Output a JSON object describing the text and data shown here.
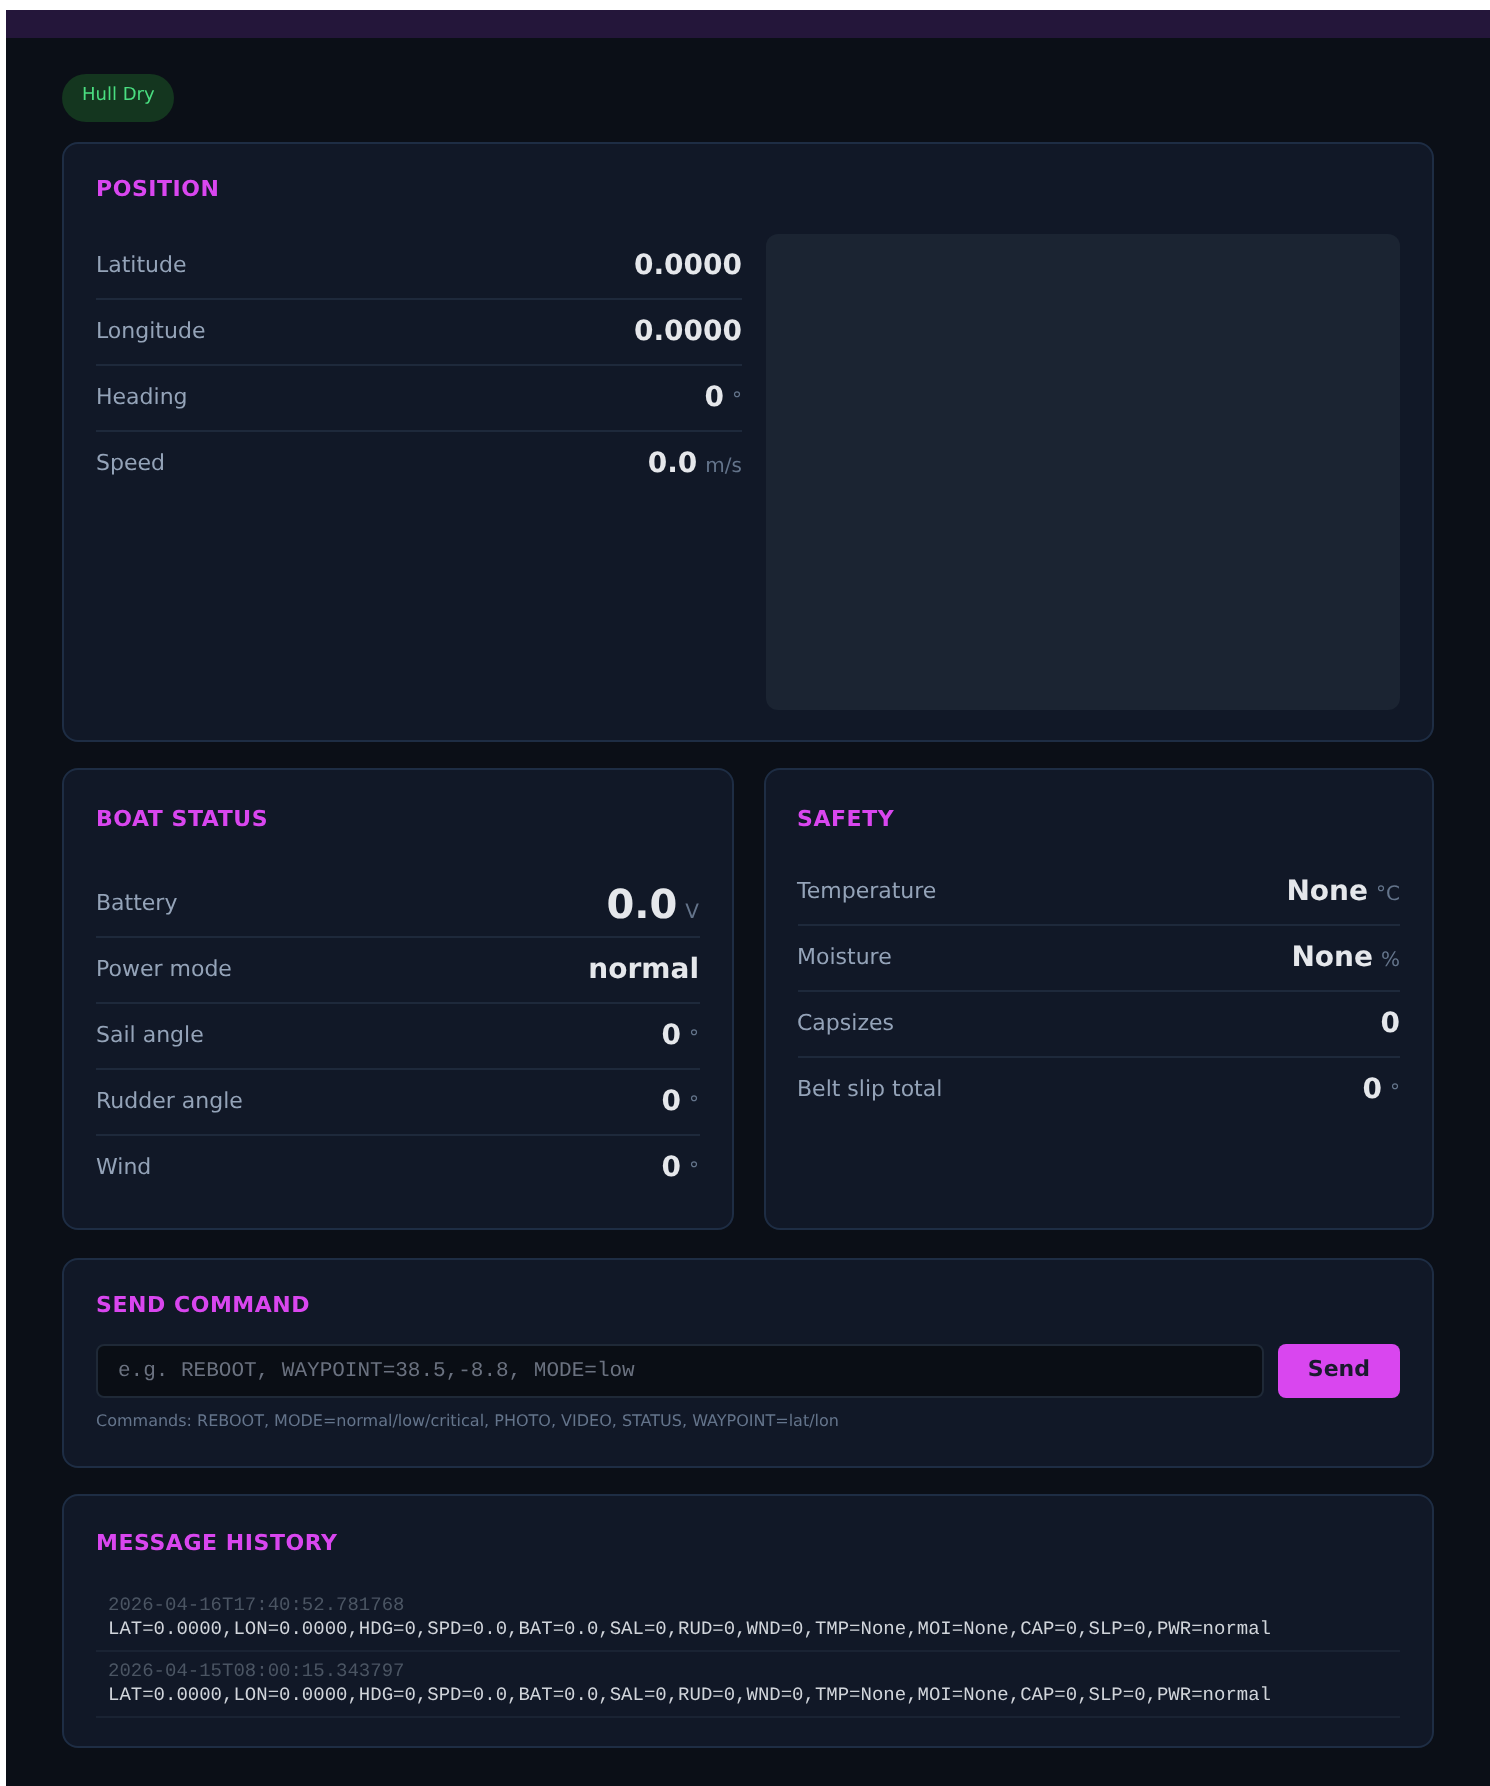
{
  "hull_badge": "Hull Dry",
  "position": {
    "title": "POSITION",
    "rows": [
      {
        "label": "Latitude",
        "value": "0.0000",
        "kind": "plain"
      },
      {
        "label": "Longitude",
        "value": "0.0000",
        "kind": "plain"
      },
      {
        "label": "Heading",
        "value": "0",
        "unit": "°",
        "kind": "plain"
      },
      {
        "label": "Speed",
        "value": "0.0",
        "unit": "m/s",
        "kind": "plain"
      }
    ]
  },
  "boat_status": {
    "title": "BOAT STATUS",
    "rows": [
      {
        "label": "Battery",
        "value": "0.0",
        "unit": "V",
        "kind": "big"
      },
      {
        "label": "Power mode",
        "value": "normal",
        "kind": "plain"
      },
      {
        "label": "Sail angle",
        "value": "0",
        "unit": "°",
        "kind": "plain"
      },
      {
        "label": "Rudder angle",
        "value": "0",
        "unit": "°",
        "kind": "plain"
      },
      {
        "label": "Wind",
        "value": "0",
        "unit": "°",
        "kind": "plain"
      }
    ]
  },
  "safety": {
    "title": "SAFETY",
    "rows": [
      {
        "label": "Temperature",
        "value": "None",
        "unit": "°C",
        "kind": "plain"
      },
      {
        "label": "Moisture",
        "value": "None",
        "unit": "%",
        "kind": "plain"
      },
      {
        "label": "Capsizes",
        "value": "0",
        "kind": "plain"
      },
      {
        "label": "Belt slip total",
        "value": "0",
        "unit": "°",
        "kind": "plain"
      }
    ]
  },
  "send_command": {
    "title": "SEND COMMAND",
    "placeholder": "e.g. REBOOT, WAYPOINT=38.5,-8.8, MODE=low",
    "button": "Send",
    "help": "Commands: REBOOT, MODE=normal/low/critical, PHOTO, VIDEO, STATUS, WAYPOINT=lat/lon"
  },
  "message_history": {
    "title": "MESSAGE HISTORY",
    "messages": [
      {
        "time": "2026-04-16T17:40:52.781768",
        "text": "LAT=0.0000,LON=0.0000,HDG=0,SPD=0.0,BAT=0.0,SAL=0,RUD=0,WND=0,TMP=None,MOI=None,CAP=0,SLP=0,PWR=normal"
      },
      {
        "time": "2026-04-15T08:00:15.343797",
        "text": "LAT=0.0000,LON=0.0000,HDG=0,SPD=0.0,BAT=0.0,SAL=0,RUD=0,WND=0,TMP=None,MOI=None,CAP=0,SLP=0,PWR=normal"
      }
    ]
  }
}
